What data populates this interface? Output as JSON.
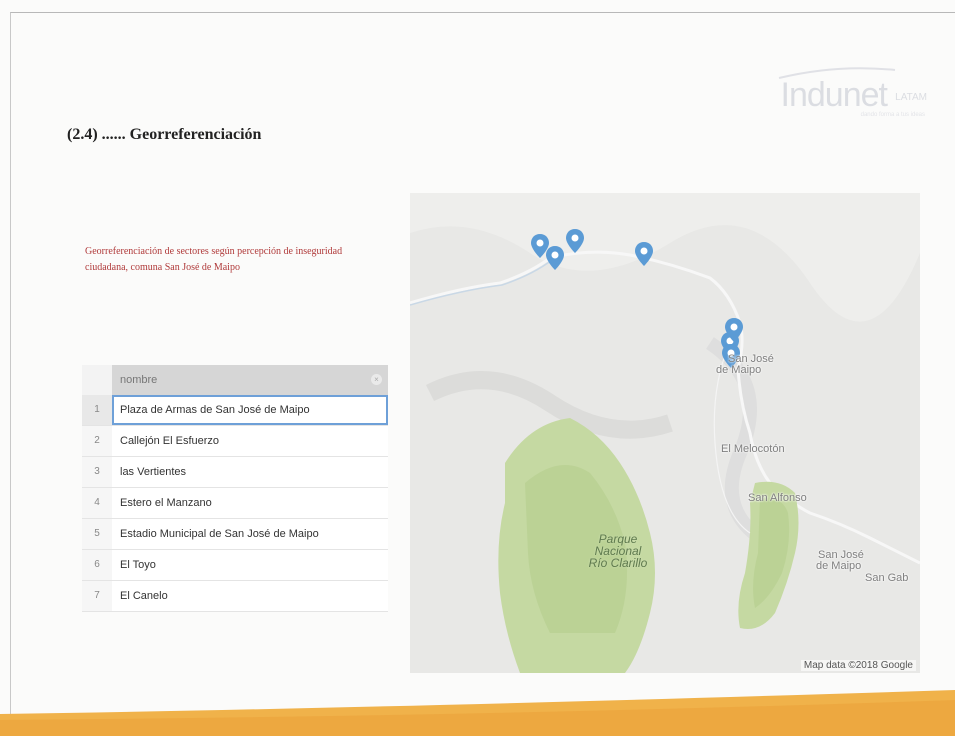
{
  "slide": {
    "title": "(2.4) ...... Georreferenciación",
    "subtitle": "Georreferenciación de sectores según percepción de inseguridad ciudadana, comuna San José de Maipo"
  },
  "logo": {
    "text": "Indunet",
    "suffix": "LATAM",
    "tagline": "dando forma a tus ideas"
  },
  "table": {
    "column_header": "nombre",
    "rows": [
      {
        "index": "1",
        "nombre": "Plaza de Armas de San José de Maipo"
      },
      {
        "index": "2",
        "nombre": "Callejón El Esfuerzo"
      },
      {
        "index": "3",
        "nombre": "las Vertientes"
      },
      {
        "index": "4",
        "nombre": "Estero el Manzano"
      },
      {
        "index": "5",
        "nombre": "Estadio Municipal de San José de Maipo"
      },
      {
        "index": "6",
        "nombre": "El Toyo"
      },
      {
        "index": "7",
        "nombre": "El Canelo"
      }
    ]
  },
  "map": {
    "labels": {
      "san_jose_1": "San José",
      "san_jose_2": "de Maipo",
      "el_melocoton": "El Melocotón",
      "san_alfonso": "San Alfonso",
      "sjm_south_1": "San José",
      "sjm_south_2": "de Maipo",
      "san_gab": "San Gab",
      "park_1": "Parque",
      "park_2": "Nacional",
      "park_3": "Río Clarillo"
    },
    "credit": "Map data ©2018 Google",
    "pin_color": "#5b9bd5"
  },
  "colors": {
    "subtitle": "#b03a3a",
    "footer_band": "#f0b24a"
  }
}
